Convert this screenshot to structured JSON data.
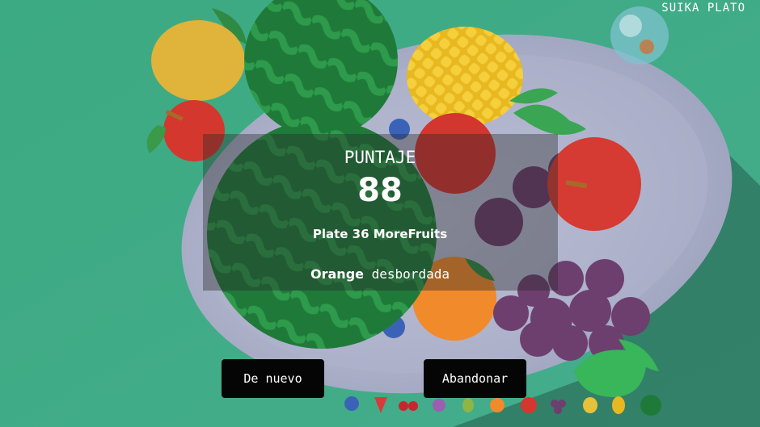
{
  "title": "SUIKA PLATO",
  "overlay": {
    "score_label": "PUNTAJE",
    "score_value": "88",
    "plate_name": "Plate 36 MoreFruits",
    "overflow_fruit": "Orange",
    "overflow_word": "desbordada"
  },
  "buttons": {
    "again_label": "De nuevo",
    "quit_label": "Abandonar"
  },
  "fruit_bar": [
    "blueberry-icon",
    "strawberry-icon",
    "cherries-icon",
    "plum-icon",
    "avocado-icon",
    "orange-icon",
    "apple-icon",
    "grapes-icon",
    "lemon-icon",
    "pineapple-icon",
    "watermelon-icon"
  ],
  "colors": {
    "background": "#3fa985",
    "plate": "#b9bdd6",
    "button_bg": "#050505",
    "text": "#ffffff"
  }
}
